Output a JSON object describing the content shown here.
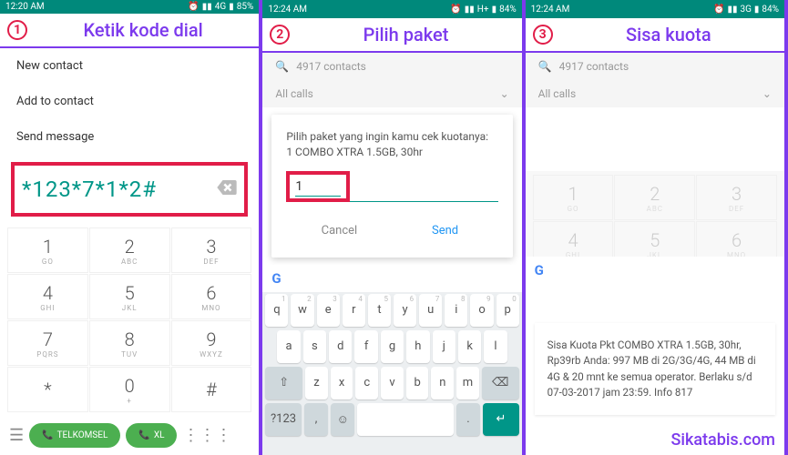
{
  "panel1": {
    "time": "12:20 AM",
    "net": "4G",
    "battery": "85%",
    "step": "1",
    "title": "Ketik kode dial",
    "menu": [
      "New contact",
      "Add to contact",
      "Send message"
    ],
    "dial_code": "*123*7*1*2#",
    "keys": [
      {
        "n": "1",
        "l": "GO"
      },
      {
        "n": "2",
        "l": "ABC"
      },
      {
        "n": "3",
        "l": "DEF"
      },
      {
        "n": "4",
        "l": "GHI"
      },
      {
        "n": "5",
        "l": "JKL"
      },
      {
        "n": "6",
        "l": "MNO"
      },
      {
        "n": "7",
        "l": "PQRS"
      },
      {
        "n": "8",
        "l": "TUV"
      },
      {
        "n": "9",
        "l": "WXYZ"
      },
      {
        "n": "*",
        "l": ""
      },
      {
        "n": "0",
        "l": "+"
      },
      {
        "n": "#",
        "l": ""
      }
    ],
    "call1": "TELKOMSEL",
    "call2": "XL"
  },
  "panel2": {
    "time": "12:24 AM",
    "net": "H+",
    "battery": "84%",
    "step": "2",
    "title": "Pilih paket",
    "search": "4917 contacts",
    "filter": "All calls",
    "dialog_text": "Pilih paket yang ingin kamu cek kuotanya:\n1 COMBO XTRA 1.5GB, 30hr",
    "input_value": "1",
    "cancel": "Cancel",
    "send": "Send",
    "row1": [
      "q",
      "w",
      "e",
      "r",
      "t",
      "y",
      "u",
      "i",
      "o",
      "p"
    ],
    "nums": [
      "1",
      "2",
      "3",
      "4",
      "5",
      "6",
      "7",
      "8",
      "9",
      "0"
    ],
    "row2": [
      "a",
      "s",
      "d",
      "f",
      "g",
      "h",
      "j",
      "k",
      "l"
    ],
    "row3": [
      "z",
      "x",
      "c",
      "v",
      "b",
      "n",
      "m"
    ],
    "sym": "?123"
  },
  "panel3": {
    "time": "12:24 AM",
    "net": "3G",
    "battery": "84%",
    "step": "3",
    "title": "Sisa kuota",
    "search": "4917 contacts",
    "filter": "All calls",
    "result": "Sisa Kuota Pkt  COMBO XTRA 1.5GB, 30hr, Rp39rb Anda: 997 MB di 2G/3G/4G,  44 MB di 4G & 20 mnt  ke semua operator. Berlaku s/d 07-03-2017 jam 23:59. Info 817",
    "keys": [
      {
        "n": "1",
        "l": "GO"
      },
      {
        "n": "2",
        "l": "ABC"
      },
      {
        "n": "3",
        "l": "DEF"
      },
      {
        "n": "4",
        "l": "GHI"
      },
      {
        "n": "5",
        "l": "JKL"
      },
      {
        "n": "6",
        "l": "MNO"
      }
    ],
    "watermark": "Sikatabis.com"
  }
}
